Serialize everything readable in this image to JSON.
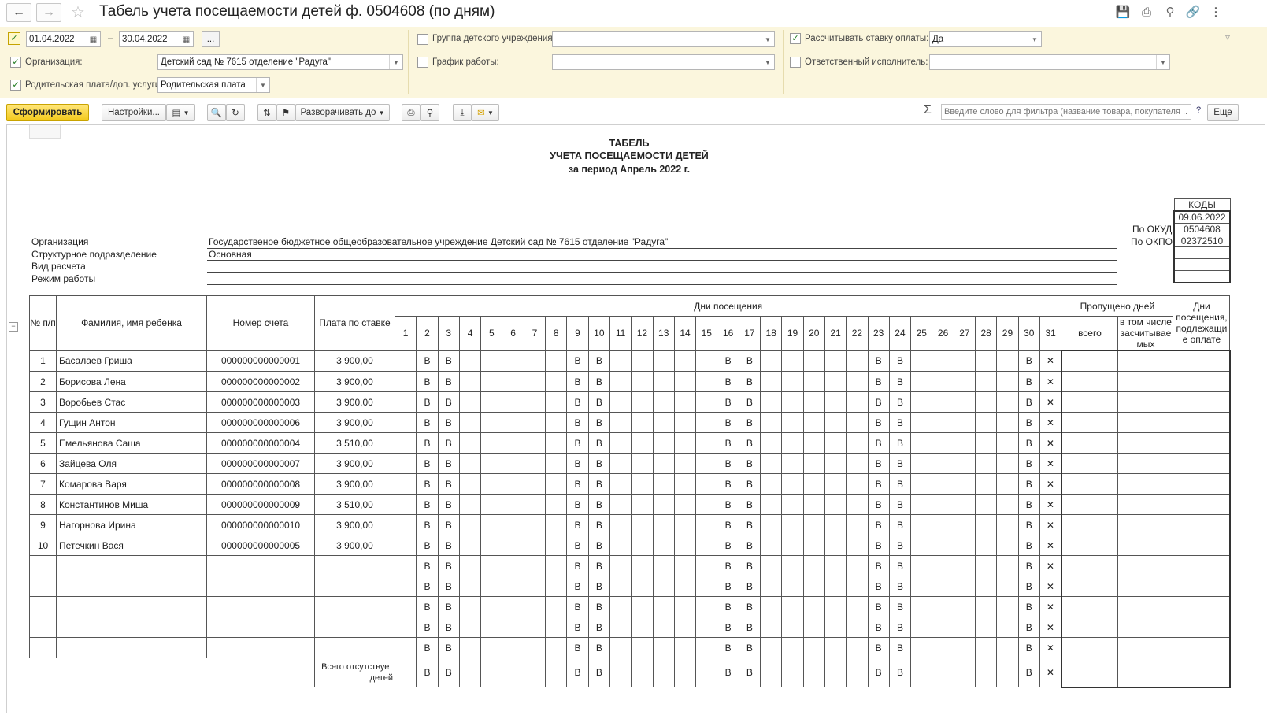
{
  "window": {
    "title": "Табель учета посещаемости детей ф. 0504608 (по дням)",
    "icons": [
      "save-icon",
      "print-icon",
      "preview-icon",
      "link-icon",
      "more-icon"
    ]
  },
  "filters": {
    "date_from": "01.04.2022",
    "date_to": "30.04.2022",
    "date_sep": "–",
    "period_btn": "...",
    "org_label": "Организация:",
    "org_value": "Детский сад № 7615 отделение \"Радуга\"",
    "parent_fee_label": "Родительская плата/доп. услуги:",
    "parent_fee_value": "Родительская плата",
    "group_label": "Группа детского учреждения:",
    "group_value": "",
    "schedule_label": "График работы:",
    "schedule_value": "",
    "rate_label": "Рассчитывать ставку оплаты:",
    "rate_value": "Да",
    "responsible_label": "Ответственный исполнитель:",
    "responsible_value": ""
  },
  "toolbar": {
    "generate": "Сформировать",
    "settings": "Настройки...",
    "expand": "Разворачивать до",
    "filter_placeholder": "Введите слово для фильтра (название товара, покупателя ...",
    "help": "?",
    "more": "Еще",
    "sigma": "Σ"
  },
  "report": {
    "title1": "ТАБЕЛЬ",
    "title2": "УЧЕТА ПОСЕЩАЕМОСТИ ДЕТЕЙ",
    "title3": "за период Апрель 2022 г.",
    "codes_header": "КОДЫ",
    "codes_date": "09.06.2022",
    "okud_label": "По ОКУД",
    "okud": "0504608",
    "okpo_label": "По ОКПО",
    "okpo": "02372510",
    "org_label": "Организация",
    "org_value": "Государственое бюджетное общеобразовательное учреждение Детский сад № 7615 отделение \"Радуга\"",
    "dept_label": "Структурное подразделение",
    "dept_value": "Основная",
    "calc_label": "Вид расчета",
    "mode_label": "Режим работы",
    "col_num": "№ п/п",
    "col_name": "Фамилия, имя ребенка",
    "col_account": "Номер счета",
    "col_rate": "Плата по ставке",
    "col_days": "Дни посещения",
    "col_missed": "Пропущено дней",
    "col_missed_total": "всего",
    "col_missed_counted": "в том числе засчитывае мых",
    "col_payable": "Дни посещения, подлежащи е оплате",
    "weekend_mark": "В",
    "absent_mark": "✕",
    "total_label": "Всего отсутствует детей",
    "days": [
      "1",
      "2",
      "3",
      "4",
      "5",
      "6",
      "7",
      "8",
      "9",
      "10",
      "11",
      "12",
      "13",
      "14",
      "15",
      "16",
      "17",
      "18",
      "19",
      "20",
      "21",
      "22",
      "23",
      "24",
      "25",
      "26",
      "27",
      "28",
      "29",
      "30",
      "31"
    ],
    "weekend_days": [
      2,
      3,
      9,
      10,
      16,
      17,
      23,
      24,
      30
    ],
    "rows": [
      {
        "n": "1",
        "name": "Басалаев Гриша",
        "account": "000000000000001",
        "rate": "3 900,00"
      },
      {
        "n": "2",
        "name": "Борисова Лена",
        "account": "000000000000002",
        "rate": "3 900,00"
      },
      {
        "n": "3",
        "name": "Воробьев Стас",
        "account": "000000000000003",
        "rate": "3 900,00"
      },
      {
        "n": "4",
        "name": "Гущин Антон",
        "account": "000000000000006",
        "rate": "3 900,00"
      },
      {
        "n": "5",
        "name": "Емельянова Саша",
        "account": "000000000000004",
        "rate": "3 510,00"
      },
      {
        "n": "6",
        "name": "Зайцева Оля",
        "account": "000000000000007",
        "rate": "3 900,00"
      },
      {
        "n": "7",
        "name": "Комарова Варя",
        "account": "000000000000008",
        "rate": "3 900,00"
      },
      {
        "n": "8",
        "name": "Константинов Миша",
        "account": "000000000000009",
        "rate": "3 510,00"
      },
      {
        "n": "9",
        "name": "Нагорнова Ирина",
        "account": "000000000000010",
        "rate": "3 900,00"
      },
      {
        "n": "10",
        "name": "Петечкин Вася",
        "account": "000000000000005",
        "rate": "3 900,00"
      },
      {
        "n": "",
        "name": "",
        "account": "",
        "rate": ""
      },
      {
        "n": "",
        "name": "",
        "account": "",
        "rate": ""
      },
      {
        "n": "",
        "name": "",
        "account": "",
        "rate": ""
      },
      {
        "n": "",
        "name": "",
        "account": "",
        "rate": ""
      },
      {
        "n": "",
        "name": "",
        "account": "",
        "rate": ""
      }
    ]
  }
}
